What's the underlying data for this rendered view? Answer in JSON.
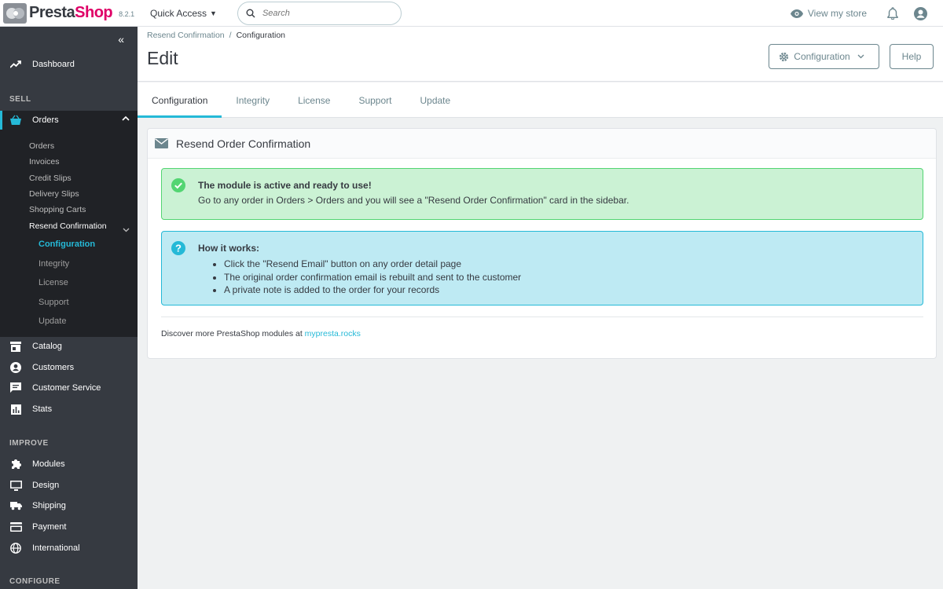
{
  "header": {
    "logo_text_a": "Presta",
    "logo_text_b": "Shop",
    "version": "8.2.1",
    "quick_access": "Quick Access",
    "search_placeholder": "Search",
    "view_store": "View my store"
  },
  "sidebar": {
    "dashboard": "Dashboard",
    "section_sell": "SELL",
    "orders": "Orders",
    "orders_sub": [
      "Orders",
      "Invoices",
      "Credit Slips",
      "Delivery Slips",
      "Shopping Carts",
      "Resend Confirmation"
    ],
    "resend_sub": [
      "Configuration",
      "Integrity",
      "License",
      "Support",
      "Update"
    ],
    "catalog": "Catalog",
    "customers": "Customers",
    "customer_service": "Customer Service",
    "stats": "Stats",
    "section_improve": "IMPROVE",
    "modules": "Modules",
    "design": "Design",
    "shipping": "Shipping",
    "payment": "Payment",
    "international": "International",
    "section_configure": "CONFIGURE"
  },
  "page": {
    "breadcrumb_parent": "Resend Confirmation",
    "breadcrumb_current": "Configuration",
    "title": "Edit",
    "config_button": "Configuration",
    "help_button": "Help"
  },
  "tabs": [
    "Configuration",
    "Integrity",
    "License",
    "Support",
    "Update"
  ],
  "panel": {
    "title": "Resend Order Confirmation",
    "success_title": "The module is active and ready to use!",
    "success_text": "Go to any order in Orders > Orders and you will see a \"Resend Order Confirmation\" card in the sidebar.",
    "info_title": "How it works:",
    "info_items": [
      "Click the \"Resend Email\" button on any order detail page",
      "The original order confirmation email is rebuilt and sent to the customer",
      "A private note is added to the order for your records"
    ],
    "discover_text": "Discover more PrestaShop modules at ",
    "discover_link": "mypresta.rocks"
  },
  "colors": {
    "accent": "#25b9d7",
    "brand_pink": "#df0067",
    "sidebar_bg": "#363a41",
    "success_bg": "#cbf2d4",
    "info_bg": "#beeaf3"
  }
}
